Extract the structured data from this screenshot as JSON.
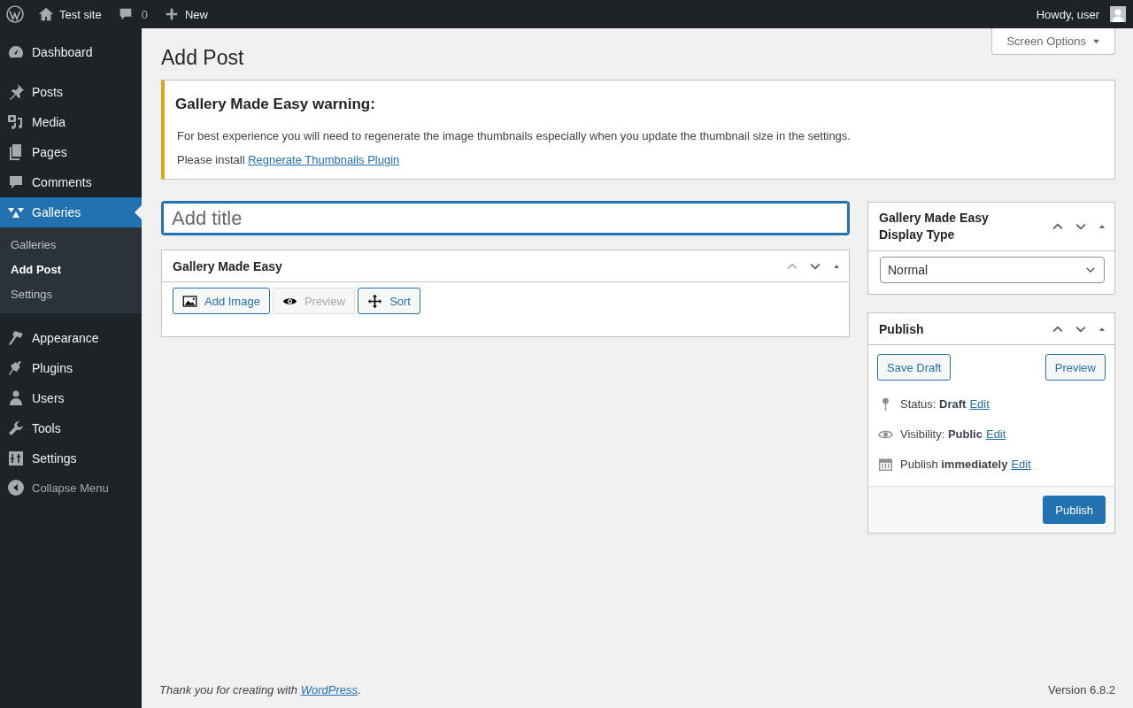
{
  "admin_bar": {
    "site_name": "Test site",
    "comments_count": "0",
    "new_label": "New",
    "greeting": "Howdy, user"
  },
  "sidebar": {
    "items": [
      {
        "label": "Dashboard",
        "selected": false
      },
      {
        "label": "Posts",
        "selected": false
      },
      {
        "label": "Media",
        "selected": false
      },
      {
        "label": "Pages",
        "selected": false
      },
      {
        "label": "Comments",
        "selected": false
      },
      {
        "label": "Galleries",
        "selected": true,
        "children": [
          {
            "label": "Galleries",
            "selected": false
          },
          {
            "label": "Add Post",
            "selected": true
          },
          {
            "label": "Settings",
            "selected": false
          }
        ]
      },
      {
        "label": "Appearance",
        "selected": false
      },
      {
        "label": "Plugins",
        "selected": false
      },
      {
        "label": "Users",
        "selected": false
      },
      {
        "label": "Tools",
        "selected": false
      },
      {
        "label": "Settings",
        "selected": false
      }
    ],
    "collapse_label": "Collapse Menu"
  },
  "screen_options": "Screen Options",
  "page_title": "Add Post",
  "notice": {
    "title": "Gallery Made Easy warning:",
    "text": "For best experience you will need to regenerate the image thumbnails especially when you update the thumbnail size in the settings.",
    "install_text": "Please install",
    "link": "Regnerate Thumbnails Plugin"
  },
  "title_field": {
    "placeholder": "Add title"
  },
  "gallery_box": {
    "title": "Gallery Made Easy",
    "move_up_disabled": true,
    "buttons": [
      {
        "label": "Add Image",
        "disabled": false
      },
      {
        "label": "Preview",
        "disabled": true
      },
      {
        "label": "Sort",
        "disabled": false
      }
    ]
  },
  "display_type_box": {
    "title": "Gallery Made Easy Display Type",
    "move_up_disabled": false,
    "value": "Normal"
  },
  "publish_box": {
    "title": "Publish",
    "move_up_disabled": false,
    "save_draft": "Save Draft",
    "preview": "Preview",
    "lines": [
      {
        "text": "Status: **Draft**",
        "edit": "Edit"
      },
      {
        "text": "Visibility: **Public**",
        "edit": "Edit"
      },
      {
        "text": "Publish **immediately**",
        "edit": "Edit"
      }
    ],
    "publish_button": "Publish"
  },
  "footer": {
    "thanks": "Thank you for creating with",
    "link": "WordPress",
    "end": ".",
    "version": "Version 6.8.2"
  }
}
